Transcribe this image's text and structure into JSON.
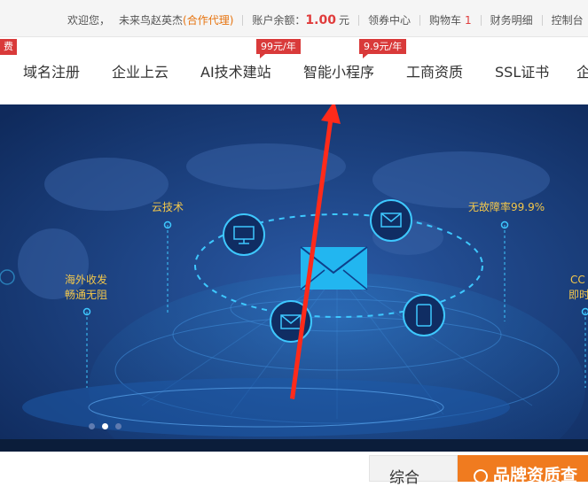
{
  "topbar": {
    "welcome": "欢迎您，",
    "username": "未来鸟赵英杰",
    "role": "(合作代理)",
    "balance_label": "账户余额：",
    "balance_value": "1.00",
    "balance_unit": "元",
    "coupon": "领券中心",
    "cart_label": "购物车",
    "cart_count": "1",
    "finance": "财务明细",
    "console": "控制台"
  },
  "nav": {
    "left_tag": "费",
    "items": [
      {
        "label": "域名注册"
      },
      {
        "label": "企业上云"
      },
      {
        "label": "AI技术建站",
        "badge": "99元/年"
      },
      {
        "label": "智能小程序",
        "badge": "9.9元/年"
      },
      {
        "label": "工商资质"
      },
      {
        "label": "SSL证书"
      },
      {
        "label": "企"
      }
    ]
  },
  "banner": {
    "labels": {
      "cloud": "云技术",
      "overseas_1": "海外收发",
      "overseas_2": "畅通无阻",
      "uptime": "无故障率99.9%",
      "cc_1": "CC",
      "cc_2": "即时"
    },
    "slides": 3,
    "active_slide": 2
  },
  "bottom": {
    "tab_general": "综合",
    "tab_brand": "品牌资质查"
  },
  "colors": {
    "accent_red": "#d93a3a",
    "accent_orange": "#f07b1f",
    "banner_bg": "#163a78",
    "label_yellow": "#f3c74b",
    "annotation_arrow": "#ff2a1a"
  }
}
